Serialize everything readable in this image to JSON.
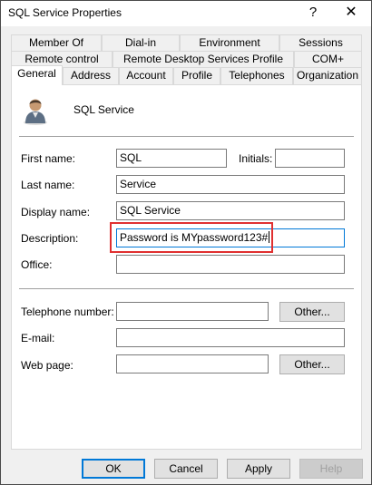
{
  "window": {
    "title": "SQL Service Properties",
    "help_glyph": "?",
    "close_glyph": "✕"
  },
  "tabs": {
    "row1": [
      "Member Of",
      "Dial-in",
      "Environment",
      "Sessions"
    ],
    "row2": [
      "Remote control",
      "Remote Desktop Services Profile",
      "COM+"
    ],
    "row3": [
      "General",
      "Address",
      "Account",
      "Profile",
      "Telephones",
      "Organization"
    ],
    "active": "General"
  },
  "general": {
    "account_name": "SQL Service",
    "first_name_label": "First name:",
    "first_name_value": "SQL",
    "initials_label": "Initials:",
    "initials_value": "",
    "last_name_label": "Last name:",
    "last_name_value": "Service",
    "display_name_label": "Display name:",
    "display_name_value": "SQL Service",
    "description_label": "Description:",
    "description_value": "Password is MYpassword123#",
    "office_label": "Office:",
    "office_value": "",
    "telephone_label": "Telephone number:",
    "telephone_value": "",
    "telephone_other": "Other...",
    "email_label": "E-mail:",
    "email_value": "",
    "webpage_label": "Web page:",
    "webpage_value": "",
    "webpage_other": "Other..."
  },
  "buttons": {
    "ok": "OK",
    "cancel": "Cancel",
    "apply": "Apply",
    "help": "Help"
  },
  "colors": {
    "highlight": "#e03030",
    "focus": "#0078d7"
  }
}
